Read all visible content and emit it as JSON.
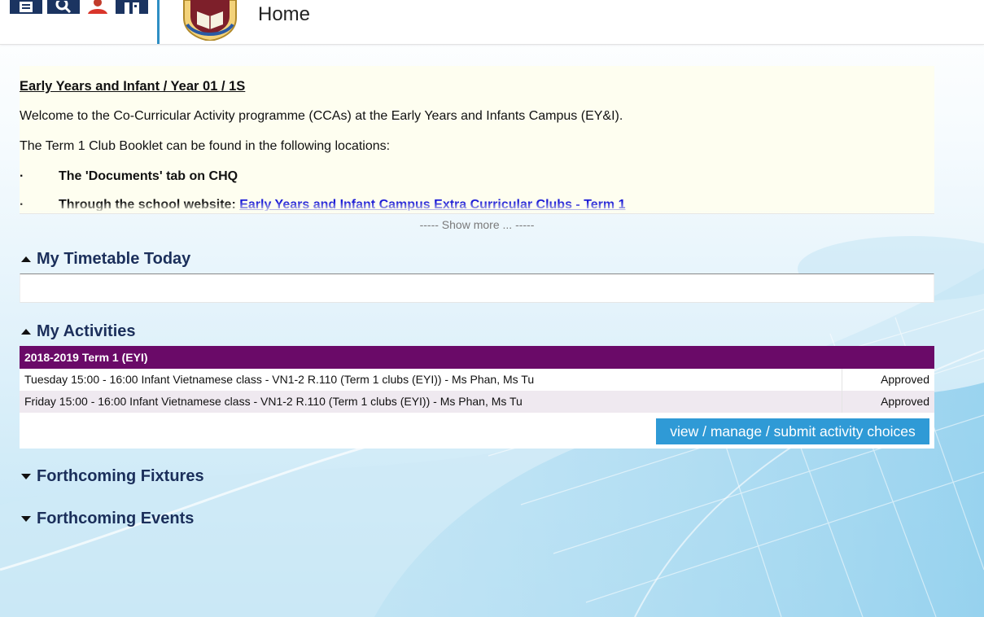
{
  "header": {
    "title": "Home",
    "icons": [
      "document-icon",
      "search-icon",
      "user-icon",
      "building-icon"
    ],
    "divider_color": "#2f8fc4",
    "icon_color": "#1b3461"
  },
  "notice": {
    "heading": "Early Years and Infant / Year 01 / 1S",
    "line1": "Welcome to the Co-Curricular Activity programme (CCAs) at the Early Years and Infants Campus (EY&I).",
    "line2": "The Term 1 Club Booklet can be found in the following locations:",
    "bullet_char": "·",
    "bullet1": "The 'Documents' tab on CHQ",
    "bullet2_prefix": "Through the school website: ",
    "bullet2_link": "Early Years and Infant Campus Extra Curricular Clubs - Term 1",
    "show_more": "----- Show more ... -----"
  },
  "sections": {
    "timetable": "My Timetable Today",
    "activities": "My Activities",
    "fixtures": "Forthcoming Fixtures",
    "events": "Forthcoming Events"
  },
  "activities": {
    "term": "2018-2019 Term 1 (EYI)",
    "term_color": "#6a0a68",
    "rows": [
      {
        "description": "Tuesday 15:00 - 16:00 Infant Vietnamese class - VN1-2 R.110 (Term 1 clubs (EYI)) - Ms Phan, Ms Tu",
        "status": "Approved"
      },
      {
        "description": "Friday 15:00 - 16:00 Infant Vietnamese class - VN1-2 R.110 (Term 1 clubs (EYI)) - Ms Phan, Ms Tu",
        "status": "Approved"
      }
    ],
    "manage_button": "view / manage / submit activity choices",
    "button_color": "#2f9ad6"
  }
}
